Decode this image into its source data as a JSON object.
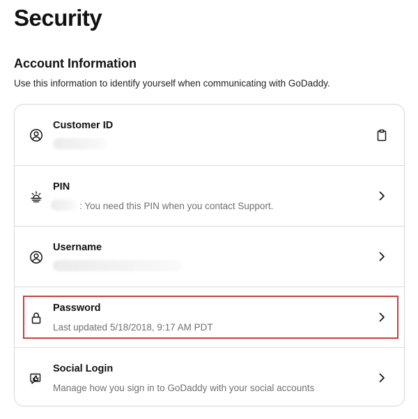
{
  "page": {
    "title": "Security"
  },
  "account_info": {
    "heading": "Account Information",
    "description": "Use this information to identify yourself when communicating with GoDaddy."
  },
  "rows": [
    {
      "label": "Customer ID",
      "subtitle": "",
      "icon": "user-circle-icon",
      "action_icon": "clipboard-icon"
    },
    {
      "label": "PIN",
      "subtitle": ": You need this PIN when you contact Support.",
      "icon": "sunrise-icon",
      "action_icon": "chevron-right-icon"
    },
    {
      "label": "Username",
      "subtitle": "",
      "icon": "user-circle-icon",
      "action_icon": "chevron-right-icon"
    },
    {
      "label": "Password",
      "subtitle": "Last updated 5/18/2018, 9:17 AM PDT",
      "icon": "lock-icon",
      "action_icon": "chevron-right-icon"
    },
    {
      "label": "Social Login",
      "subtitle": "Manage how you sign in to GoDaddy with your social accounts",
      "icon": "thumbs-up-chat-icon",
      "action_icon": "chevron-right-icon"
    }
  ],
  "highlight_color": "#cf3a3a"
}
